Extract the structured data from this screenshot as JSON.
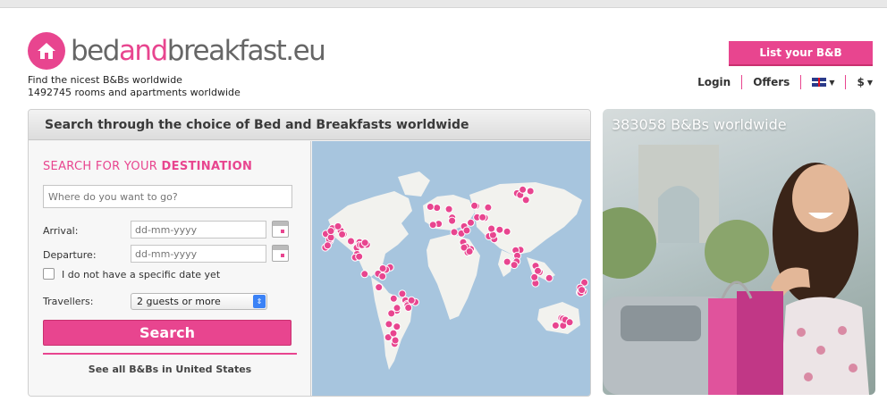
{
  "header": {
    "logo_part1": "bed",
    "logo_part2": "and",
    "logo_part3": "breakfast",
    "logo_part4": ".eu",
    "tagline": "Find the nicest B&Bs worldwide",
    "rooms": "1492745 rooms and apartments worldwide",
    "list_button": "List your B&B",
    "nav": {
      "login": "Login",
      "offers": "Offers",
      "currency": "$"
    }
  },
  "search": {
    "panel_title": "Search through the choice of Bed and Breakfasts worldwide",
    "dest_prefix": "SEARCH FOR YOUR ",
    "dest_strong": "DESTINATION",
    "where_placeholder": "Where do you want to go?",
    "arrival_label": "Arrival:",
    "departure_label": "Departure:",
    "date_placeholder": "dd-mm-yyyy",
    "no_date_label": "I do not have a specific date yet",
    "travellers_label": "Travellers:",
    "travellers_value": "2 guests or more",
    "search_button": "Search",
    "see_all": "See all B&Bs in United States"
  },
  "hero": {
    "title": "383058 B&Bs worldwide"
  },
  "colors": {
    "brand": "#e8458f",
    "map_water": "#a7c5de",
    "map_land": "#f2f2ee"
  },
  "icons": [
    "house-logo-icon",
    "uk-flag-icon",
    "calendar-icon",
    "select-arrow-icon",
    "map-pin-icon"
  ]
}
